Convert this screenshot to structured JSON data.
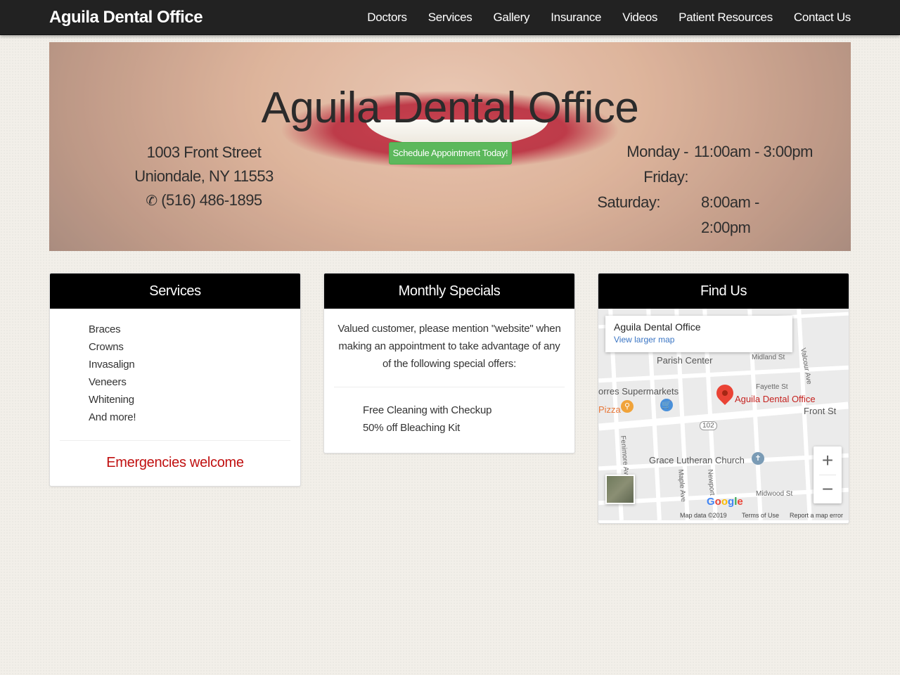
{
  "nav": {
    "brand": "Aguila Dental Office",
    "items": [
      "Doctors",
      "Services",
      "Gallery",
      "Insurance",
      "Videos",
      "Patient Resources",
      "Contact Us"
    ]
  },
  "hero": {
    "title": "Aguila Dental Office",
    "address_line1": "1003 Front Street",
    "address_line2": "Uniondale, NY 11553",
    "phone": "(516) 486-1895",
    "cta": "Schedule Appointment Today!",
    "hours": [
      {
        "day": "Monday - Friday:",
        "time": "11:00am - 3:00pm"
      },
      {
        "day": "Saturday:",
        "time": "8:00am - 2:00pm"
      }
    ]
  },
  "services": {
    "heading": "Services",
    "items": [
      "Braces",
      "Crowns",
      "Invasalign",
      "Veneers",
      "Whitening",
      "And more!"
    ],
    "emergency": "Emergencies welcome"
  },
  "specials": {
    "heading": "Monthly Specials",
    "intro": "Valued customer, please mention \"website\" when making an appointment to take advantage of any of the following special offers:",
    "items": [
      "Free Cleaning with Checkup",
      "50% off Bleaching Kit"
    ]
  },
  "findus": {
    "heading": "Find Us",
    "map": {
      "info_name": "Aguila Dental Office",
      "info_link": "View larger map",
      "marker_label": "Aguila Dental Office",
      "labels": {
        "parish": "Parish Center",
        "supermarkets": "orres Supermarkets",
        "pizza": "Pizza",
        "church": "Grace Lutheran Church",
        "front_st": "Front St",
        "route": "102",
        "midland": "Midland St",
        "fayette": "Fayette St",
        "valcour": "Valcour Ave",
        "fenimore": "Fenimore Av",
        "maple": "Maple Ave",
        "newport": "Newport",
        "midwood": "Midwood St"
      },
      "zoom_in": "+",
      "zoom_out": "−",
      "google": "Google",
      "map_data": "Map data ©2019",
      "terms": "Terms of Use",
      "report": "Report a map error"
    }
  },
  "colors": {
    "navbar": "#222222",
    "cta": "#5cb85c",
    "emergency": "#c01010",
    "panel_heading": "#000000",
    "map_pin": "#ea4335"
  }
}
